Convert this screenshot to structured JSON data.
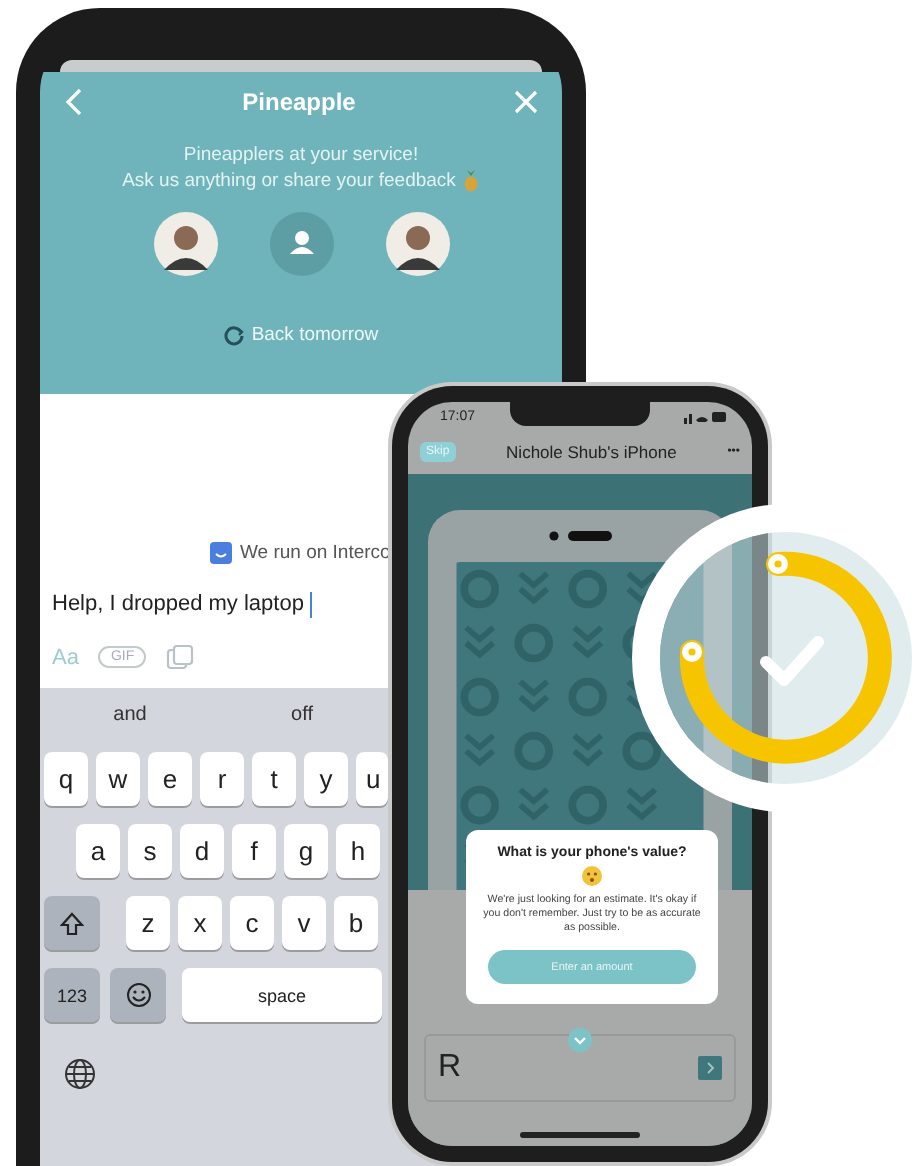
{
  "chat_phone": {
    "header": {
      "title": "Pineapple",
      "greeting": [
        "Pineapplers at your service!",
        "Ask us anything or share your feedback"
      ],
      "avatars": [
        {
          "kind": "photo"
        },
        {
          "kind": "placeholder"
        },
        {
          "kind": "photo"
        }
      ],
      "reply_time": "Back tomorrow"
    },
    "branding": "We run on Interco",
    "composer": {
      "value": "Help, I dropped my laptop",
      "format_label": "Aa",
      "gif_label": "GIF"
    },
    "keyboard": {
      "suggestions": [
        "and",
        "off"
      ],
      "rows": [
        [
          "q",
          "w",
          "e",
          "r",
          "t",
          "y",
          "u"
        ],
        [
          "a",
          "s",
          "d",
          "f",
          "g",
          "h"
        ],
        [
          "z",
          "x",
          "c",
          "v",
          "b"
        ]
      ],
      "number_key": "123",
      "space_key": "space"
    }
  },
  "setup_phone": {
    "time": "17:07",
    "skip_button": "Skip",
    "device_name": "Nichole Shub's iPhone",
    "menu": "•••",
    "dialog": {
      "title": "What is your phone's value?",
      "body": "We're just looking for an estimate. It's okay if you don't remember. Just try to be as accurate as possible.",
      "button": "Enter an amount"
    },
    "amount_field": {
      "currency": "R"
    }
  }
}
